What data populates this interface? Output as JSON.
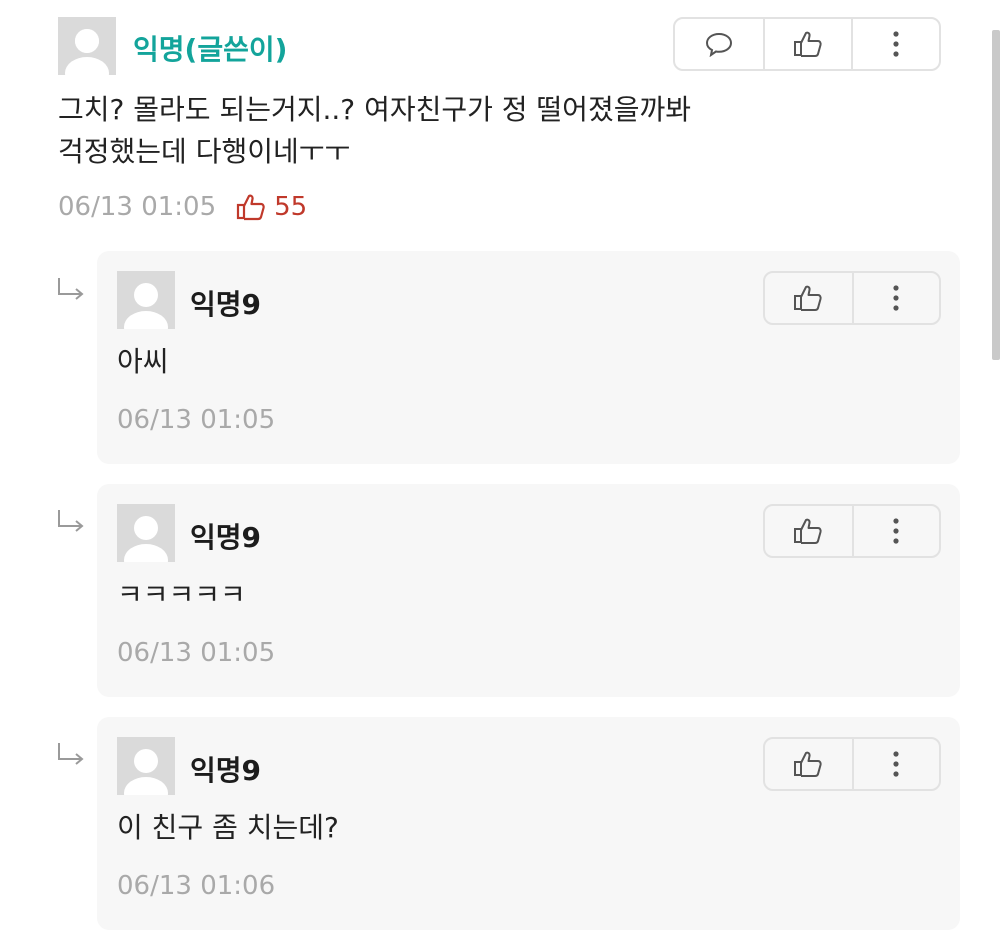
{
  "comment": {
    "author": "익명(글쓴이)",
    "text": "그치? 몰라도 되는거지..? 여자친구가 정 떨어졌을까봐\n걱정했는데 다행이네ㅜㅜ",
    "timestamp": "06/13 01:05",
    "likes": "55",
    "actions": [
      "reply-icon",
      "like-icon",
      "more-icon"
    ]
  },
  "replies": [
    {
      "author": "익명9",
      "text": "아씨",
      "timestamp": "06/13 01:05"
    },
    {
      "author": "익명9",
      "text": "ㅋㅋㅋㅋㅋ",
      "timestamp": "06/13 01:05"
    },
    {
      "author": "익명9",
      "text": "이 친구 좀 치는데?",
      "timestamp": "06/13 01:06"
    }
  ],
  "colors": {
    "op_name": "#13a49b",
    "like_accent": "#c0392b",
    "muted": "#a9a9a9",
    "card_bg": "#f7f7f7"
  }
}
